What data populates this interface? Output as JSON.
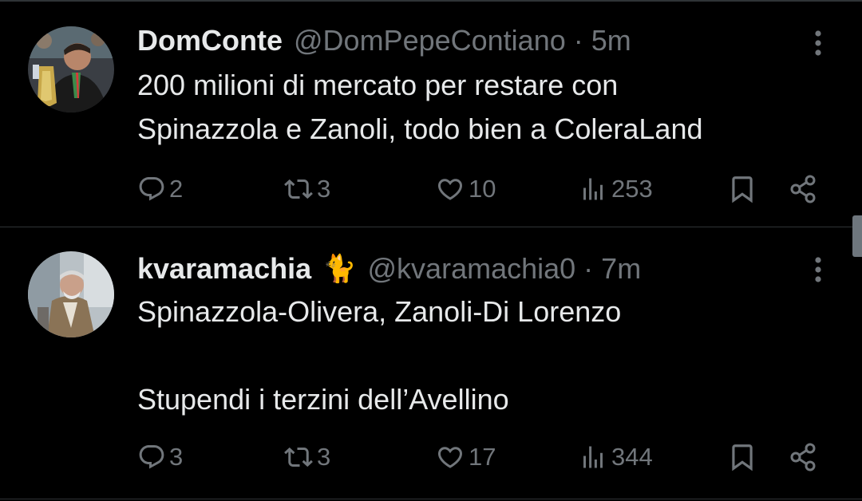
{
  "tweets": [
    {
      "display_name": "DomConte",
      "emoji": "",
      "handle": "@DomPepeContiano",
      "separator": "·",
      "time": "5m",
      "text": "200 milioni di mercato per restare con\nSpinazzola e Zanoli, todo bien a ColeraLand",
      "replies": "2",
      "retweets": "3",
      "likes": "10",
      "views": "253"
    },
    {
      "display_name": "kvaramachia",
      "emoji": "🐈",
      "handle": "@kvaramachia0",
      "separator": "·",
      "time": "7m",
      "text": "Spinazzola-Olivera, Zanoli-Di Lorenzo\n\nStupendi i terzini dell’Avellino",
      "replies": "3",
      "retweets": "3",
      "likes": "17",
      "views": "344"
    }
  ],
  "icons": {
    "reply": "reply-icon",
    "retweet": "retweet-icon",
    "like": "heart-icon",
    "views": "views-icon",
    "bookmark": "bookmark-icon",
    "share": "share-icon",
    "more": "more-options-icon"
  },
  "colors": {
    "background": "#000000",
    "primary_text": "#e7e9ea",
    "secondary_text": "#71767b",
    "divider": "#2f3336"
  }
}
